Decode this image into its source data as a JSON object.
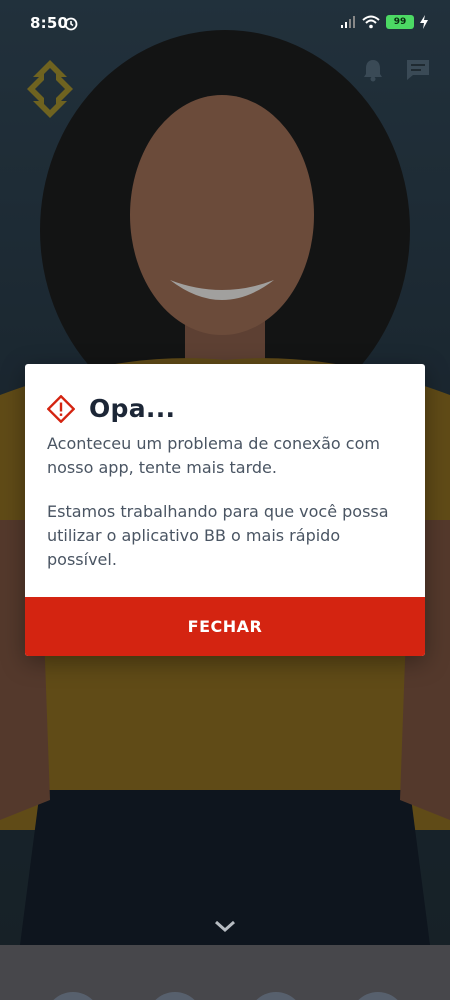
{
  "status_bar": {
    "time": "8:50",
    "battery": "99"
  },
  "icons": {
    "logo": "banco-do-brasil-logo",
    "notifications": "bell-icon",
    "messages": "chat-icon",
    "alarm": "alarm-icon",
    "warning": "warning-icon",
    "scroll": "chevron-down-icon"
  },
  "dialog": {
    "title": "Opa...",
    "message_1": "Aconteceu um problema de conexão com nosso app, tente mais tarde.",
    "message_2": "Estamos trabalhando para que você possa utilizar o aplicativo BB o mais rápido possível.",
    "close_label": "FECHAR"
  },
  "colors": {
    "accent_red": "#d42411",
    "brand_yellow": "#f6c800",
    "title_navy": "#1c2636"
  }
}
